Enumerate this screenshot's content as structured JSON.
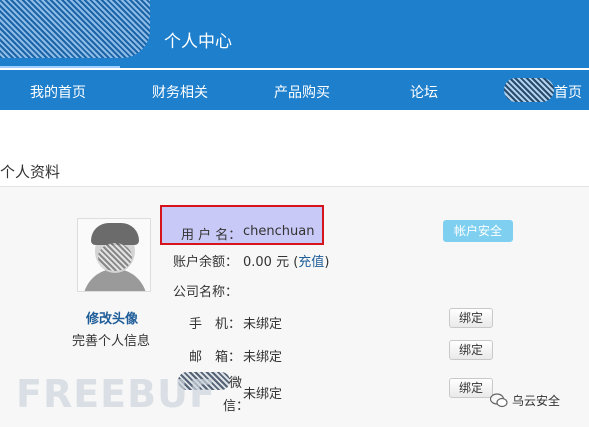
{
  "header": {
    "title": "个人中心"
  },
  "nav": {
    "items": [
      "我的首页",
      "财务相关",
      "产品购买",
      "论坛",
      "首页"
    ]
  },
  "section": {
    "title": "个人资料"
  },
  "profile": {
    "edit_avatar": "修改头像",
    "complete_info": "完善个人信息",
    "username": {
      "label": "用 户 名：",
      "value": "chenchuan"
    },
    "balance": {
      "label": "账户余额：",
      "value": "0.00 元",
      "open_paren": "(",
      "link": "充值",
      "close_paren": ")"
    },
    "company": {
      "label": "公司名称：",
      "value": ""
    },
    "phone": {
      "label": "手　机：",
      "value": "未绑定",
      "button": "绑定"
    },
    "email": {
      "label": "邮　箱：",
      "value": "未绑定",
      "button": "绑定"
    },
    "wechat": {
      "label_top": "微",
      "label_bottom": "信：",
      "value": "未绑定",
      "button": "绑定"
    },
    "account_security": "帐户安全"
  },
  "watermark": {
    "freebuf": "FREEBUF",
    "brand": "乌云安全"
  },
  "colors": {
    "header": "#1e7fcc",
    "link": "#1f5d99",
    "highlight_border": "#d6141c",
    "highlight_fill": "#c8c9f6"
  }
}
